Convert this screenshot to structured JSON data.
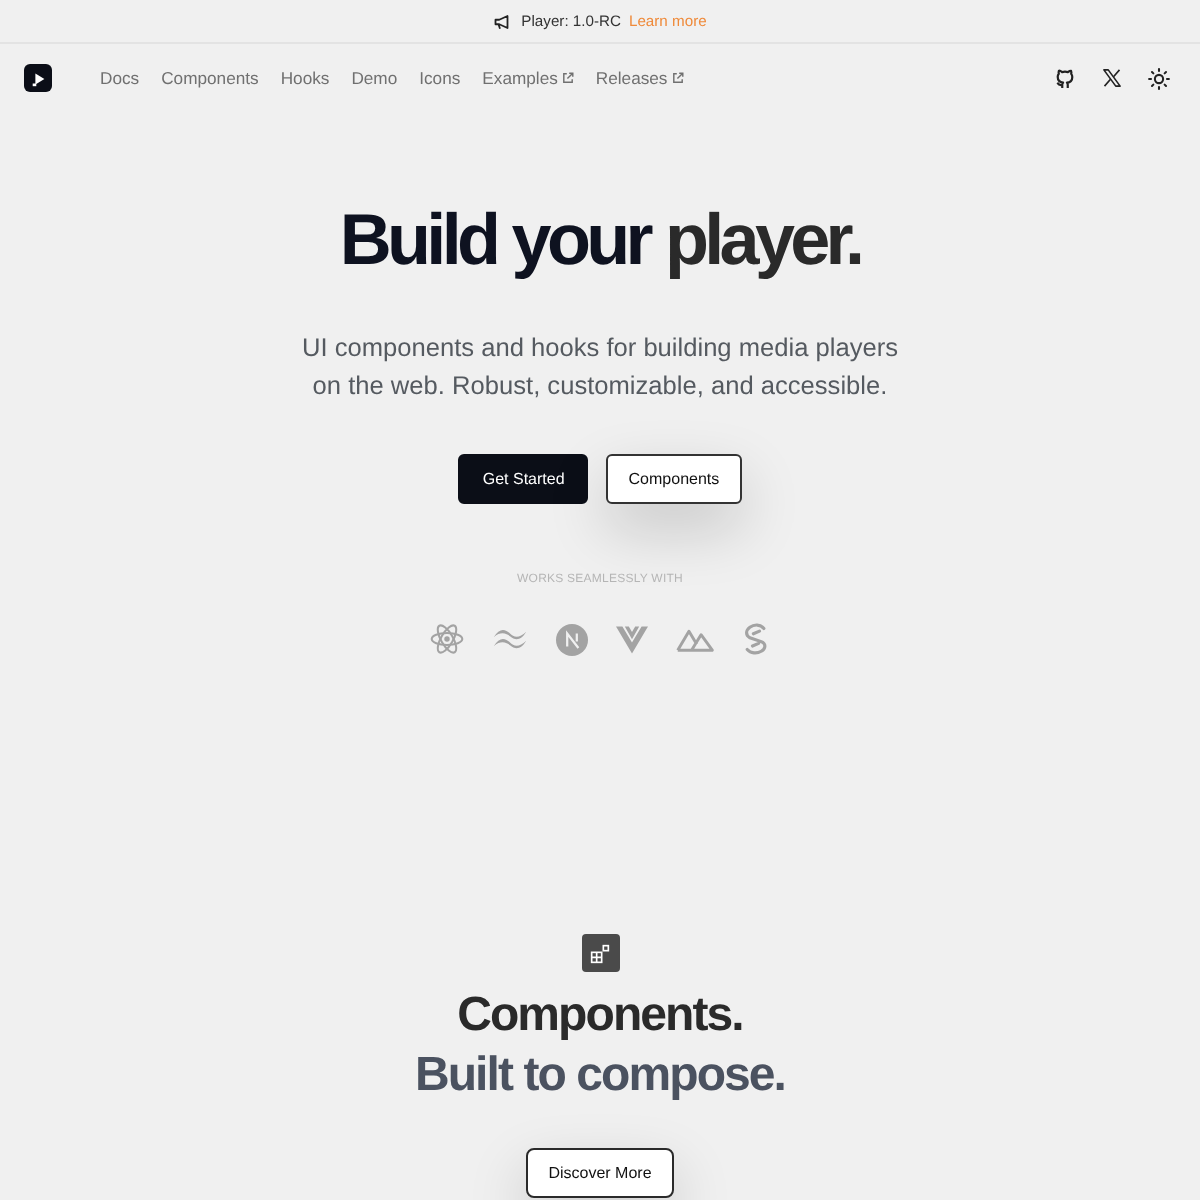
{
  "announcement": {
    "label": "Player: 1.0-RC",
    "link": "Learn more"
  },
  "nav": {
    "links": [
      {
        "label": "Docs",
        "external": false
      },
      {
        "label": "Components",
        "external": false
      },
      {
        "label": "Hooks",
        "external": false
      },
      {
        "label": "Demo",
        "external": false
      },
      {
        "label": "Icons",
        "external": false
      },
      {
        "label": "Examples",
        "external": true
      },
      {
        "label": "Releases",
        "external": true
      }
    ]
  },
  "hero": {
    "title_lead": "Build your",
    "title_tail": "player.",
    "description": "UI components and hooks for building media players on the web. Robust, customizable, and accessible.",
    "buttons": [
      {
        "label": "Get Started",
        "kind": "primary"
      },
      {
        "label": "Components",
        "kind": "outline"
      }
    ],
    "integrations_label": "WORKS SEAMLESSLY WITH"
  },
  "features": {
    "heading": "Components.",
    "subheading": "Built to compose.",
    "button": "Discover More"
  }
}
